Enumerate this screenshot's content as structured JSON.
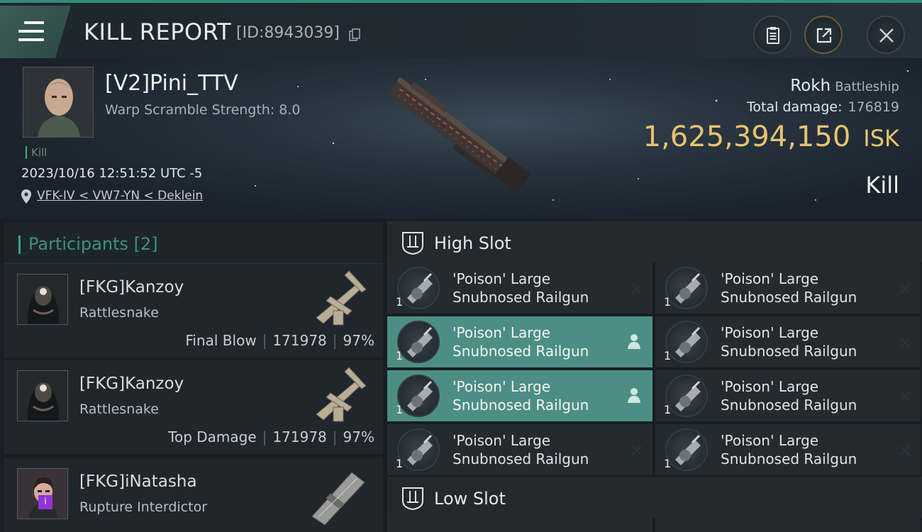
{
  "header": {
    "title": "KILL REPORT",
    "report_id": "[ID:8943039]"
  },
  "victim": {
    "name": "[V2]Pini_TTV",
    "subtitle": "Warp Scramble Strength: 8.0",
    "kill_tag": "Kill",
    "timestamp": "2023/10/16 12:51:52 UTC -5",
    "location": "VFK-IV < VW7-YN < Deklein",
    "ship": "Rokh",
    "ship_class": "Battleship",
    "total_damage_label": "Total damage:",
    "total_damage": "176819",
    "isk_value": "1,625,394,150",
    "isk_unit": "ISK",
    "result": "Kill"
  },
  "participants": {
    "header": "Participants [2]",
    "items": [
      {
        "name": "[FKG]Kanzoy",
        "ship": "Rattlesnake",
        "role": "Final Blow",
        "damage": "171978",
        "percent": "97%"
      },
      {
        "name": "[FKG]Kanzoy",
        "ship": "Rattlesnake",
        "role": "Top Damage",
        "damage": "171978",
        "percent": "97%"
      },
      {
        "name": "[FKG]iNatasha",
        "ship": "Rupture Interdictor",
        "badge": "i"
      }
    ]
  },
  "high_slot": {
    "title": "High Slot",
    "modules": [
      {
        "line1": "'Poison' Large",
        "line2": "Snubnosed Railgun",
        "qty": "1",
        "state": "destroyed"
      },
      {
        "line1": "'Poison' Large",
        "line2": "Snubnosed Railgun",
        "qty": "1",
        "state": "destroyed"
      },
      {
        "line1": "'Poison' Large",
        "line2": "Snubnosed Railgun",
        "qty": "1",
        "state": "dropped"
      },
      {
        "line1": "'Poison' Large",
        "line2": "Snubnosed Railgun",
        "qty": "1",
        "state": "destroyed"
      },
      {
        "line1": "'Poison' Large",
        "line2": "Snubnosed Railgun",
        "qty": "1",
        "state": "dropped"
      },
      {
        "line1": "'Poison' Large",
        "line2": "Snubnosed Railgun",
        "qty": "1",
        "state": "destroyed"
      },
      {
        "line1": "'Poison' Large",
        "line2": "Snubnosed Railgun",
        "qty": "1",
        "state": "destroyed"
      },
      {
        "line1": "'Poison' Large",
        "line2": "Snubnosed Railgun",
        "qty": "1",
        "state": "destroyed"
      }
    ]
  },
  "low_slot": {
    "title": "Low Slot"
  },
  "status_symbols": {
    "destroyed": "✕"
  },
  "colors": {
    "accent": "#39a08e",
    "isk": "#e8c370",
    "highlight_row": "#4d8e84",
    "interdictor_badge": "#8e34d8"
  }
}
